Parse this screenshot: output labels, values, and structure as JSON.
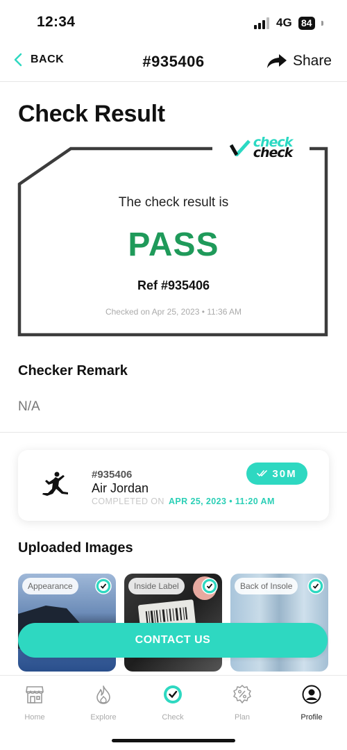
{
  "status_bar": {
    "time": "12:34",
    "network": "4G",
    "battery": "84"
  },
  "nav": {
    "back_label": "BACK",
    "title": "#935406",
    "share_label": "Share"
  },
  "page_title": "Check Result",
  "brand": {
    "line1": "check",
    "line2": "check"
  },
  "result": {
    "intro": "The check result is",
    "status": "PASS",
    "ref": "Ref #935406",
    "checked_on": "Checked on Apr 25, 2023 • 11:36 AM",
    "status_color": "#1f9a5a"
  },
  "remark": {
    "title": "Checker Remark",
    "value": "N/A"
  },
  "order": {
    "id": "#935406",
    "name": "Air Jordan",
    "completed_label": "COMPLETED ON",
    "completed_date": "APR 25, 2023 • 11:20 AM",
    "duration": "30M",
    "icon": "jumpman-logo"
  },
  "images": {
    "title": "Uploaded Images",
    "items": [
      {
        "label": "Appearance"
      },
      {
        "label": "Inside Label"
      },
      {
        "label": "Back of Insole"
      }
    ]
  },
  "contact_button": "CONTACT US",
  "tabbar": {
    "items": [
      {
        "label": "Home",
        "icon": "store-icon"
      },
      {
        "label": "Explore",
        "icon": "flame-icon"
      },
      {
        "label": "Check",
        "icon": "check-circle-icon"
      },
      {
        "label": "Plan",
        "icon": "percent-badge-icon"
      },
      {
        "label": "Profile",
        "icon": "user-circle-icon"
      }
    ]
  },
  "colors": {
    "accent": "#2ed8c1",
    "pass": "#1f9a5a",
    "text": "#111111"
  }
}
